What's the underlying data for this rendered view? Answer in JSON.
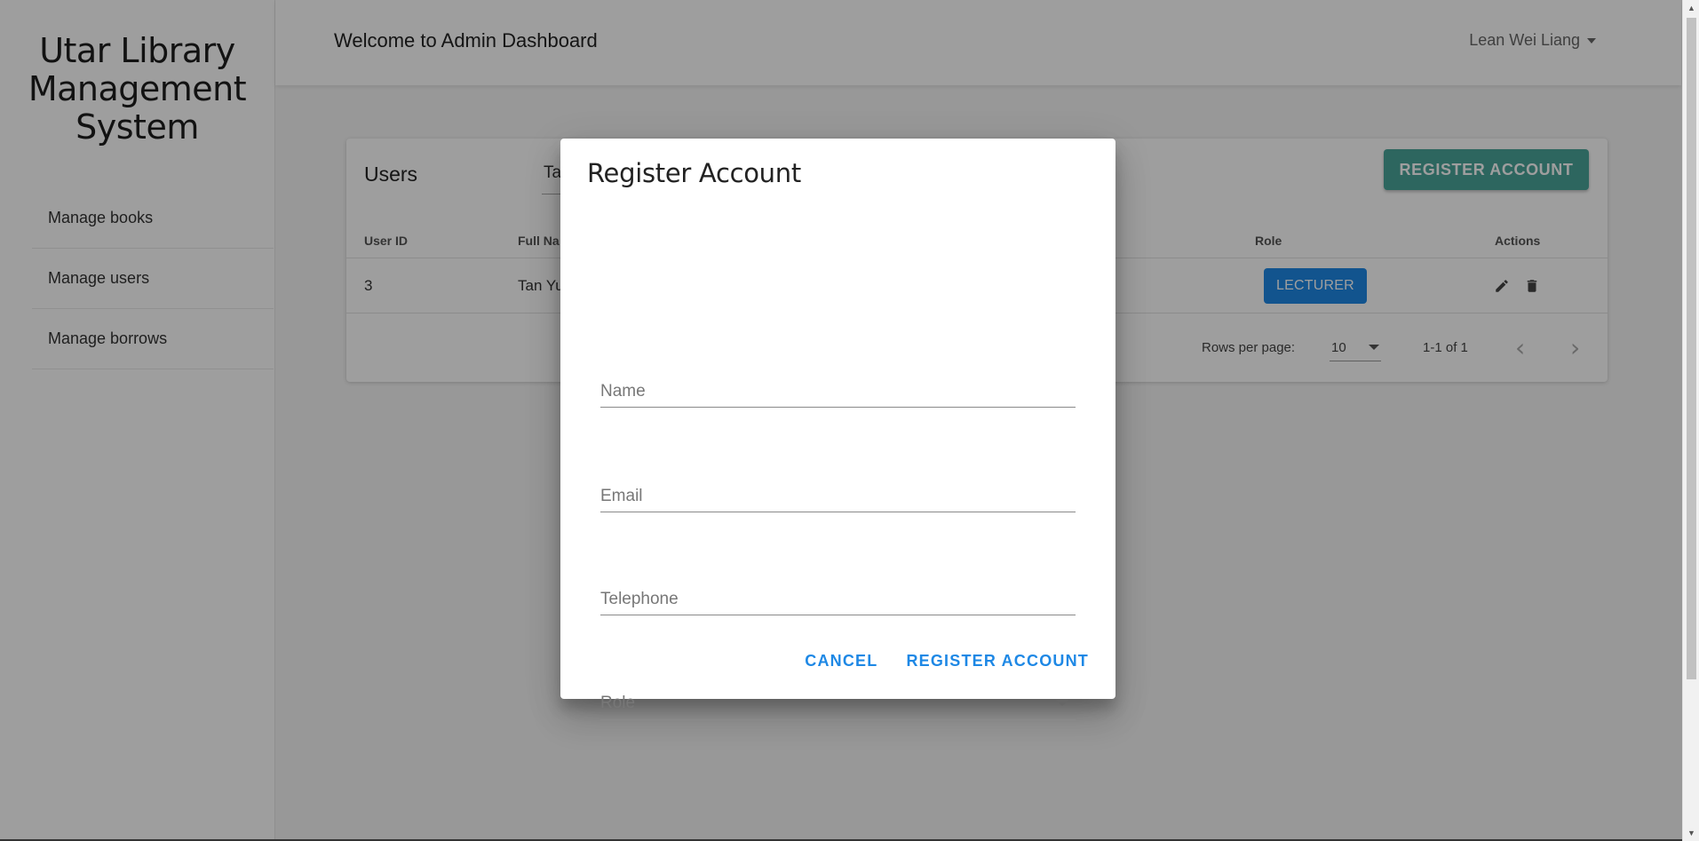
{
  "sidebar": {
    "brand": "Utar Library Management System",
    "items": [
      {
        "label": "Manage books"
      },
      {
        "label": "Manage users"
      },
      {
        "label": "Manage borrows"
      }
    ]
  },
  "header": {
    "welcome": "Welcome to Admin Dashboard",
    "user": "Lean Wei Liang"
  },
  "users_card": {
    "title": "Users",
    "search_value": "Ta",
    "register_button": "REGISTER ACCOUNT",
    "columns": {
      "user_id": "User ID",
      "full_name": "Full Na",
      "role": "Role",
      "actions": "Actions"
    },
    "rows": [
      {
        "user_id": "3",
        "full_name": "Tan Yu",
        "role": "LECTURER"
      }
    ],
    "pagination": {
      "rows_per_page_label": "Rows per page:",
      "rows_per_page": "10",
      "range": "1-1 of 1"
    }
  },
  "dialog": {
    "title": "Register Account",
    "fields": {
      "name_placeholder": "Name",
      "email_placeholder": "Email",
      "telephone_placeholder": "Telephone",
      "role_label": "Role"
    },
    "cancel": "CANCEL",
    "submit": "REGISTER ACCOUNT"
  },
  "colors": {
    "accent": "#1e88e5",
    "teal_button": "#4aa59a",
    "overlay": "rgba(0,0,0,0.38)"
  },
  "icons": [
    "edit-icon",
    "delete-icon",
    "chevron-left-icon",
    "chevron-right-icon",
    "dropdown-caret-icon"
  ]
}
